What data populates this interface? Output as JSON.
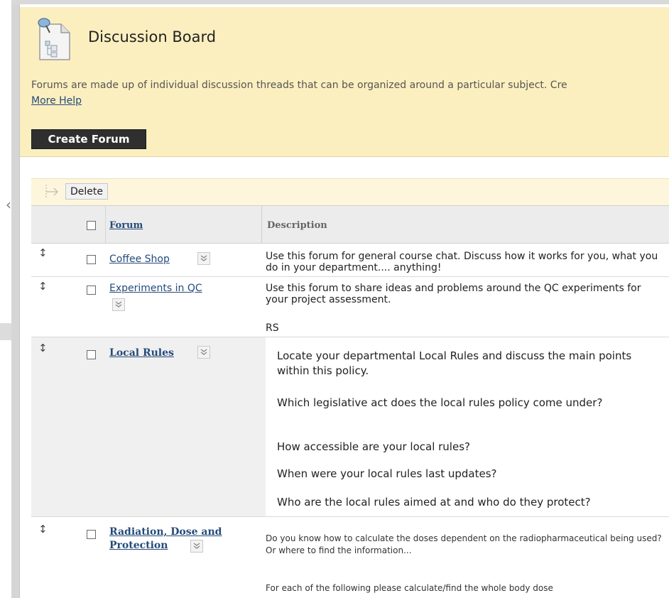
{
  "header": {
    "title": "Discussion Board",
    "intro": "Forums are made up of individual discussion threads that can be organized around a particular subject. Cre",
    "more_help": "More Help",
    "create_forum_label": "Create Forum"
  },
  "action_bar": {
    "delete_label": "Delete"
  },
  "table": {
    "col_forum": "Forum",
    "col_description": "Description",
    "rows": [
      {
        "name": "Coffee Shop",
        "description": "Use this forum for general course chat. Discuss how it works for you, what you do in your department.... anything!"
      },
      {
        "name": "Experiments in QC",
        "description": "Use this forum to share ideas and problems around the QC experiments for your project assessment.",
        "note": "RS"
      },
      {
        "name": "Local Rules",
        "description_lines": [
          "Locate your departmental Local Rules and discuss the main points within this policy.",
          "Which legislative act does the local rules policy come under?",
          "How accessible are your local rules?",
          "When were your local rules last updates?",
          "Who are the local rules aimed at and who do they protect?"
        ]
      },
      {
        "name_line1": "Radiation, Dose and",
        "name_line2": "Protection",
        "description_1": "Do you know how to calculate the doses dependent on the radiopharmaceutical being used? Or where to find the information...",
        "description_2": "For each of the following please calculate/find the whole body dose"
      }
    ]
  }
}
